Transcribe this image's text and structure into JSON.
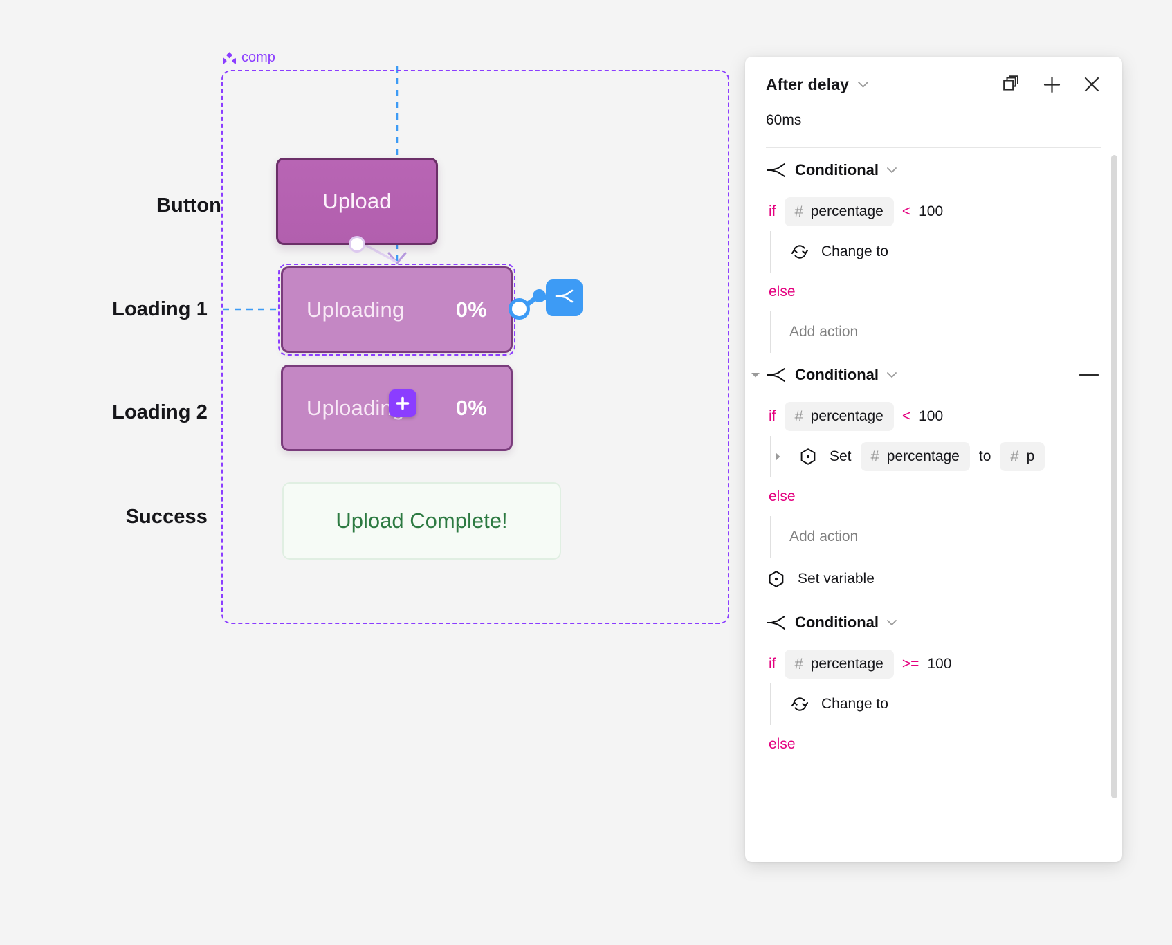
{
  "canvas": {
    "component_tag": {
      "label": "comp",
      "icon": "component-diamond-icon",
      "color": "#8b3dff"
    },
    "state_labels": {
      "button": "Button",
      "loading1": "Loading 1",
      "loading2": "Loading 2",
      "success": "Success"
    },
    "nodes": {
      "upload": {
        "label": "Upload"
      },
      "loading1": {
        "label": "Uploading",
        "percent": "0%"
      },
      "loading2": {
        "label": "Uploading",
        "percent": "0%"
      },
      "success": {
        "label": "Upload Complete!"
      }
    },
    "badges": {
      "plus": "+",
      "interaction": "conditional-branch-icon"
    },
    "colors": {
      "frame_purple": "#8b3dff",
      "node_fill": "#c487c4",
      "node_fill_dark": "#b25fae",
      "node_border": "#7a3c7c",
      "success_text": "#2d7a42",
      "success_bg": "#f6fbf6",
      "interaction_blue": "#3d9bf5"
    }
  },
  "panel": {
    "title": "After delay",
    "delay_value": "60ms",
    "header_icons": {
      "duplicate": "duplicate-icon",
      "add": "plus-icon",
      "close": "close-icon"
    },
    "blocks": [
      {
        "type": "conditional",
        "title": "Conditional",
        "if_keyword": "if",
        "variable": "percentage",
        "operator": "<",
        "value": "100",
        "then_action": "Change to",
        "else_keyword": "else",
        "else_action": "Add action",
        "collapsible": false,
        "has_minus": false
      },
      {
        "type": "conditional",
        "title": "Conditional",
        "if_keyword": "if",
        "variable": "percentage",
        "operator": "<",
        "value": "100",
        "then_set": {
          "verb": "Set",
          "target": "percentage",
          "to_word": "to",
          "source_clipped": "p"
        },
        "else_keyword": "else",
        "else_action": "Add action",
        "collapsible": true,
        "has_minus": true
      },
      {
        "type": "action",
        "title": "Set variable"
      },
      {
        "type": "conditional",
        "title": "Conditional",
        "if_keyword": "if",
        "variable": "percentage",
        "operator": ">=",
        "value": "100",
        "then_action": "Change to",
        "else_keyword": "else",
        "collapsible": false,
        "has_minus": false
      }
    ],
    "colors": {
      "keyword_pink": "#e4007f",
      "token_bg": "#f2f2f2",
      "muted_text": "#808080"
    }
  }
}
